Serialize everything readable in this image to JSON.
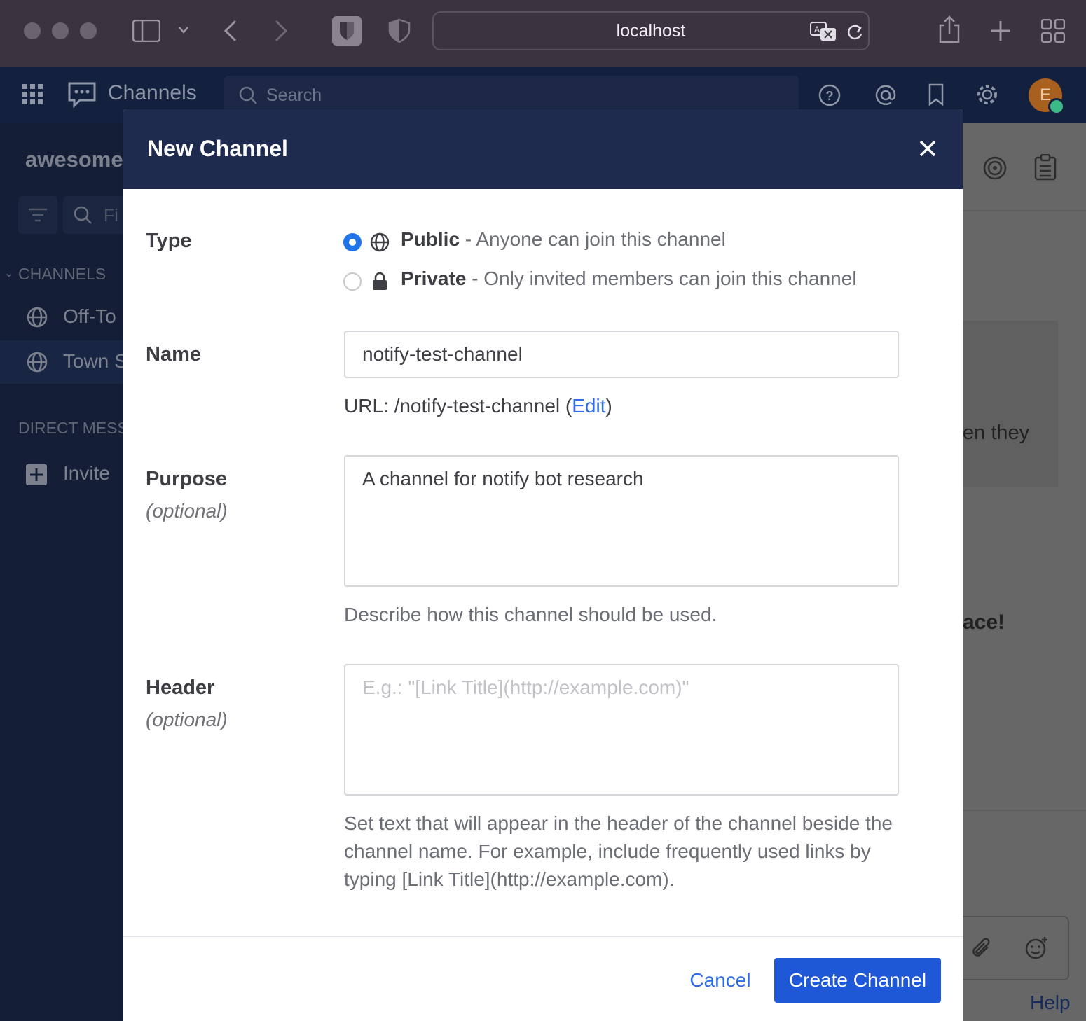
{
  "browser": {
    "url": "localhost"
  },
  "app": {
    "title": "Channels",
    "search_placeholder": "Search",
    "avatar_initial": "E"
  },
  "sidebar": {
    "team_name": "awesome",
    "find_placeholder": "Fi",
    "channels_section": "CHANNELS",
    "channels": [
      {
        "label": "Off-To"
      },
      {
        "label": "Town S"
      }
    ],
    "direct_section": "DIRECT MESS",
    "invite_label": "Invite"
  },
  "main_fragments": {
    "line1": "en they",
    "line2": "ace!",
    "help": "Help"
  },
  "modal": {
    "title": "New Channel",
    "type_label": "Type",
    "public_label": "Public",
    "public_desc": " - Anyone can join this channel",
    "private_label": "Private",
    "private_desc": " - Only invited members can join this channel",
    "name_label": "Name",
    "name_value": "notify-test-channel",
    "url_prefix": "URL: /notify-test-channel (",
    "url_edit": "Edit",
    "url_suffix": ")",
    "purpose_label": "Purpose",
    "optional": "(optional)",
    "purpose_value": "A channel for notify bot research",
    "purpose_help": "Describe how this channel should be used.",
    "header_label": "Header",
    "header_placeholder": "E.g.: \"[Link Title](http://example.com)\"",
    "header_help": "Set text that will appear in the header of the channel beside the channel name. For example, include frequently used links by typing [Link Title](http://example.com).",
    "cancel_label": "Cancel",
    "create_label": "Create Channel",
    "selected_type": "public"
  },
  "colors": {
    "accent": "#1e58d6",
    "modal_header": "#1e2a4e",
    "link": "#2e6be6"
  }
}
